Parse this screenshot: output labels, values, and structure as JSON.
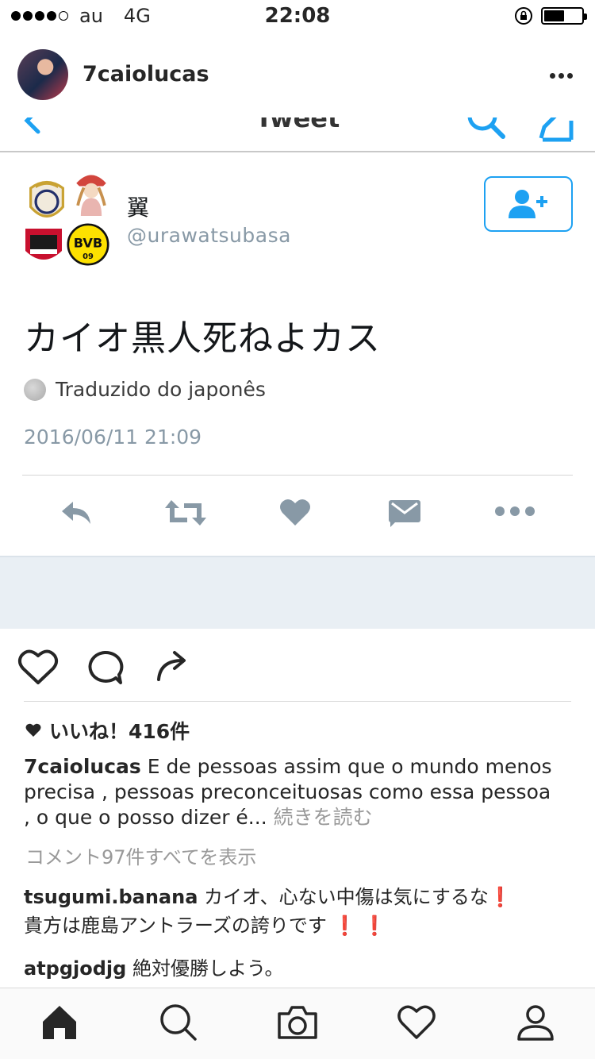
{
  "status_bar": {
    "carrier": "au",
    "network": "4G",
    "time": "22:08",
    "battery_level": 0.55
  },
  "header": {
    "username": "7caiolucas",
    "more_icon": "more-horizontal-icon"
  },
  "tweet": {
    "nav_title": "Tweet",
    "author_name": "翼",
    "author_handle": "@urawatsubasa",
    "text": "カイオ黒人死ねよカス",
    "translate_label": "Traduzido do japonês",
    "timestamp": "2016/06/11 21:09",
    "colors": {
      "accent": "#1da1f2",
      "icon": "#8899a6"
    }
  },
  "post": {
    "likes_label": "いいね！416件",
    "caption_user": "7caiolucas",
    "caption_text": "E de pessoas assim que o mundo menos precisa , pessoas preconceituosas como essa pessoa , o que o posso dizer é...",
    "more_label": "続きを読む",
    "view_comments": "コメント97件すべてを表示",
    "comments": [
      {
        "user": "tsugumi.banana",
        "text": "カイオ、心ない中傷は気にするな",
        "text2": "貴方は鹿島アントラーズの誇りです"
      },
      {
        "user": "atpgjodjg",
        "text": "絶対優勝しよう。"
      }
    ],
    "exclamation": "❗"
  },
  "tab_bar": {
    "items": [
      "home-icon",
      "search-icon",
      "camera-icon",
      "heart-icon",
      "profile-icon"
    ]
  }
}
